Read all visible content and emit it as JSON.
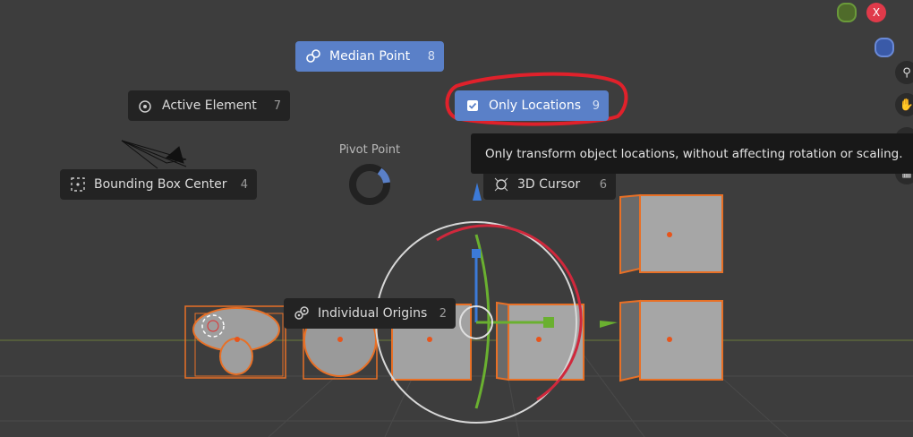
{
  "pie_menu": {
    "title": "Pivot Point",
    "items": [
      {
        "key": "median",
        "label": "Median Point",
        "shortcut": "8",
        "icon": "median-point-icon"
      },
      {
        "key": "active",
        "label": "Active Element",
        "shortcut": "7",
        "icon": "active-element-icon"
      },
      {
        "key": "only",
        "label": "Only Locations",
        "shortcut": "9",
        "icon": "checkbox-icon",
        "checked": true
      },
      {
        "key": "bbox",
        "label": "Bounding Box Center",
        "shortcut": "4",
        "icon": "bounding-box-icon"
      },
      {
        "key": "cursor",
        "label": "3D Cursor",
        "shortcut": "6",
        "icon": "cursor-3d-icon"
      },
      {
        "key": "individual",
        "label": "Individual Origins",
        "shortcut": "2",
        "icon": "individual-origins-icon"
      }
    ]
  },
  "tooltip": {
    "text": "Only transform object locations, without affecting rotation or scaling."
  },
  "colors": {
    "viewport": "#3d3d3d",
    "menu_bg": "#232323",
    "active": "#5a80c8",
    "selection": "#e87026",
    "annotation": "#e0212b"
  }
}
